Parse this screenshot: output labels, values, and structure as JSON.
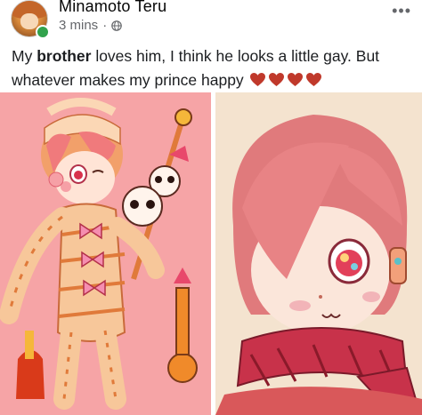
{
  "post": {
    "author_name": "Minamoto Teru",
    "timestamp": "3 mins",
    "separator": "·",
    "more_menu": "•••",
    "text_before": "My ",
    "text_bold": "brother",
    "text_after": "  loves him, I think he looks a little gay. But whatever makes my prince    happy",
    "hearts": [
      "heart-emoji",
      "heart-emoji",
      "heart-emoji",
      "heart-emoji"
    ],
    "heart_color": "#c0392b",
    "privacy_icon": "globe-icon"
  },
  "photos": [
    {
      "name": "left-photo",
      "background": "#f6a4a6"
    },
    {
      "name": "right-photo",
      "background": "#f4e3cf"
    }
  ],
  "colors": {
    "meta_gray": "#65676b",
    "online_green": "#31a24c"
  }
}
